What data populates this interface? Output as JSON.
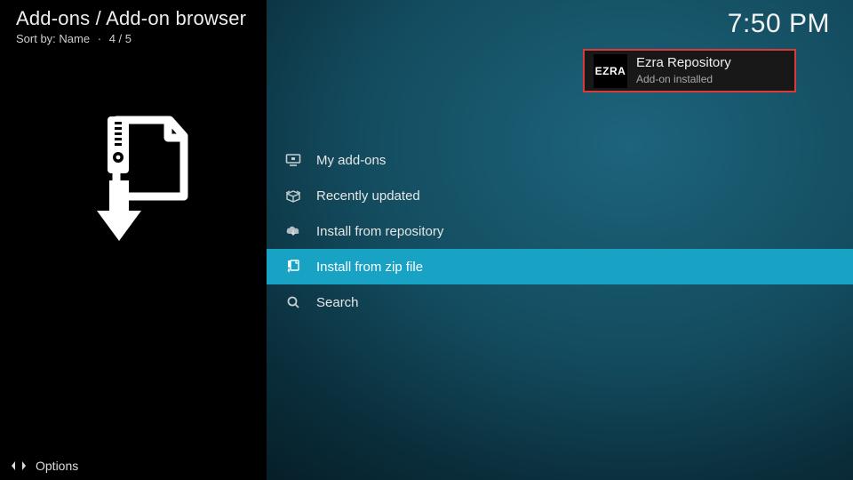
{
  "header": {
    "breadcrumb": "Add-ons / Add-on browser",
    "sort_label": "Sort by: Name",
    "position": "4 / 5"
  },
  "clock": "7:50 PM",
  "toast": {
    "icon_text": "EZRA",
    "title": "Ezra Repository",
    "subtitle": "Add-on installed"
  },
  "menu": {
    "items": [
      {
        "label": "My add-ons"
      },
      {
        "label": "Recently updated"
      },
      {
        "label": "Install from repository"
      },
      {
        "label": "Install from zip file"
      },
      {
        "label": "Search"
      }
    ],
    "selected_index": 3
  },
  "footer": {
    "options_label": "Options"
  }
}
